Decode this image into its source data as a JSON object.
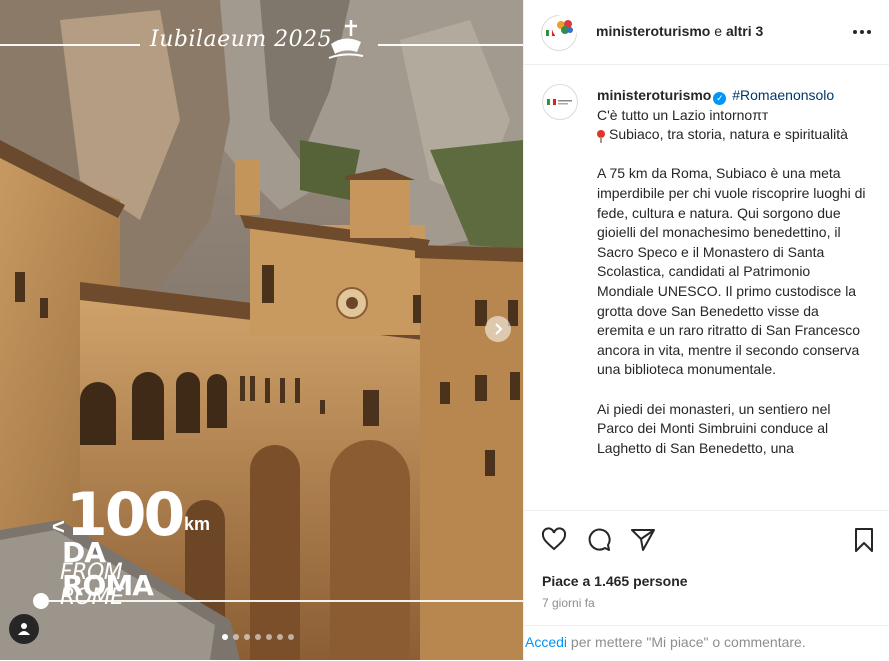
{
  "media": {
    "banner_text": "Iubilaeum 2025",
    "overlay": {
      "arrow": "<",
      "number": "100",
      "unit": "km",
      "line1": "DA ROMA",
      "line2": "FROM ROME"
    },
    "progress": 0.0,
    "carousel_dots": 7,
    "active_dot": 0,
    "icons": [
      "jubilee-logo-icon",
      "chevron-right-icon",
      "user-icon"
    ]
  },
  "header": {
    "account": "ministeroturismo",
    "connector": " e ",
    "others": "altri 3",
    "more_icon": "more-horizontal-icon"
  },
  "caption": {
    "username": "ministeroturismo",
    "verified_icon": "verified-icon",
    "hashtag": "#Romaenonsolo",
    "line1": "C'è tutto un Lazio intornoπт",
    "line2": "Subiaco, tra storia, natura e spiritualità",
    "paragraph1": "A 75 km da Roma, Subiaco è una meta imperdibile per chi vuole riscoprire luoghi di fede, cultura e natura. Qui sorgono due gioielli del monachesimo benedettino, il Sacro Speco e il Monastero di Santa Scolastica, candidati al Patrimonio Mondiale UNESCO. Il primo custodisce la grotta dove San Benedetto visse da eremita e un raro ritratto di San Francesco ancora in vita, mentre il secondo conserva una biblioteca monumentale.",
    "paragraph2": "Ai piedi dei monasteri, un sentiero nel Parco dei Monti Simbruini conduce al Laghetto di San Benedetto, una"
  },
  "actions": {
    "icons": [
      "heart-icon",
      "comment-icon",
      "share-icon",
      "bookmark-icon"
    ],
    "likes": "Piace a 1.465 persone",
    "time": "7 giorni fa"
  },
  "login": {
    "link": "Accedi",
    "text": " per mettere \"Mi piace\" o commentare."
  },
  "colors": {
    "link_blue": "#0095f6",
    "hashtag": "#00376b",
    "text": "#262626",
    "muted": "#8e8e8e"
  }
}
